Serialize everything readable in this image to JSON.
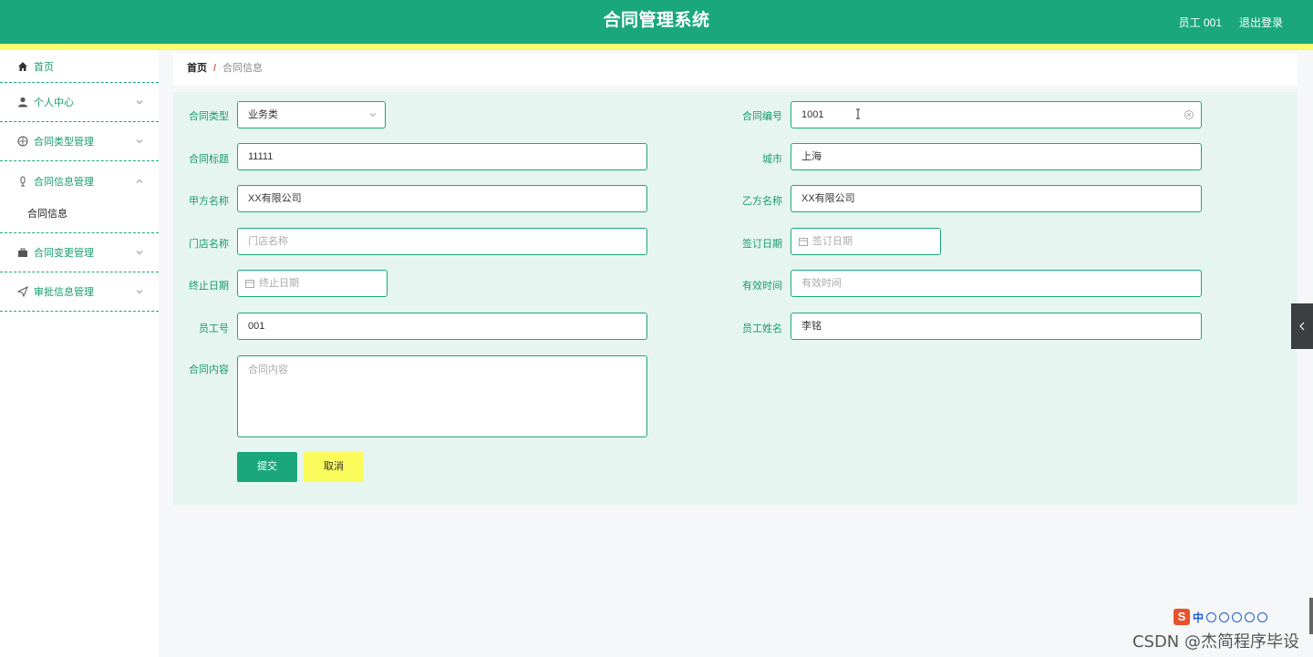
{
  "header": {
    "title": "合同管理系统",
    "user": "员工 001",
    "logout": "退出登录"
  },
  "sidebar": {
    "items": [
      {
        "label": "首页",
        "icon": "home-icon"
      },
      {
        "label": "个人中心",
        "icon": "user-icon"
      },
      {
        "label": "合同类型管理",
        "icon": "compass-icon"
      },
      {
        "label": "合同信息管理",
        "icon": "microphone-icon",
        "submenu": [
          "合同信息"
        ]
      },
      {
        "label": "合同变更管理",
        "icon": "briefcase-icon"
      },
      {
        "label": "审批信息管理",
        "icon": "send-icon"
      }
    ]
  },
  "breadcrumb": {
    "home": "首页",
    "separator": "/",
    "current": "合同信息"
  },
  "form": {
    "contract_type": {
      "label": "合同类型",
      "value": "业务类"
    },
    "contract_no": {
      "label": "合同编号",
      "value": "1001"
    },
    "contract_title": {
      "label": "合同标题",
      "value": "11111"
    },
    "city": {
      "label": "城市",
      "value": "上海"
    },
    "party_a": {
      "label": "甲方名称",
      "value": "XX有限公司"
    },
    "party_b": {
      "label": "乙方名称",
      "value": "XX有限公司"
    },
    "store_name": {
      "label": "门店名称",
      "placeholder": "门店名称"
    },
    "sign_date": {
      "label": "签订日期",
      "placeholder": "签订日期"
    },
    "end_date": {
      "label": "终止日期",
      "placeholder": "终止日期"
    },
    "valid_time": {
      "label": "有效时间",
      "placeholder": "有效时间"
    },
    "employee_no": {
      "label": "员工号",
      "value": "001"
    },
    "employee_name": {
      "label": "员工姓名",
      "value": "李铭"
    },
    "content": {
      "label": "合同内容",
      "placeholder": "合同内容"
    },
    "submit": "提交",
    "cancel": "取消"
  },
  "watermark": "CSDN @杰简程序毕设",
  "ime": {
    "logo": "S",
    "mode": "中"
  },
  "colors": {
    "primary": "#1aa87b",
    "accent_yellow": "#f8fb6d",
    "panel_bg": "#e6f5ef"
  }
}
